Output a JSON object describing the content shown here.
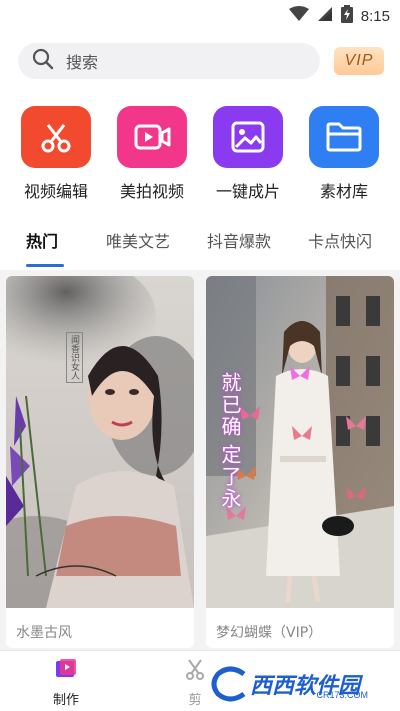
{
  "status_bar": {
    "time": "8:15"
  },
  "search": {
    "placeholder": "搜索",
    "vip_label": "VIP"
  },
  "features": [
    {
      "label": "视频编辑",
      "icon": "scissors-icon",
      "color": "#f24a2e"
    },
    {
      "label": "美拍视频",
      "icon": "video-camera-icon",
      "color": "#f2378b"
    },
    {
      "label": "一键成片",
      "icon": "image-icon",
      "color": "#8b3bef"
    },
    {
      "label": "素材库",
      "icon": "folder-icon",
      "color": "#2f7ff2"
    }
  ],
  "tabs": [
    "热门",
    "唯美文艺",
    "抖音爆款",
    "卡点快闪"
  ],
  "cards": [
    {
      "title": "水墨古风",
      "stamp_text": "闻香识女人"
    },
    {
      "title": "梦幻蝴蝶（VIP）",
      "overlay_text_1": "就已确",
      "overlay_text_2": "定了永"
    }
  ],
  "bottom_nav": [
    {
      "label": "制作",
      "active": true
    },
    {
      "label": "剪",
      "active": false
    }
  ],
  "watermark": {
    "text": "西西软件园",
    "sub": "CR173.COM"
  },
  "colors": {
    "accent": "#2f6bd8"
  }
}
